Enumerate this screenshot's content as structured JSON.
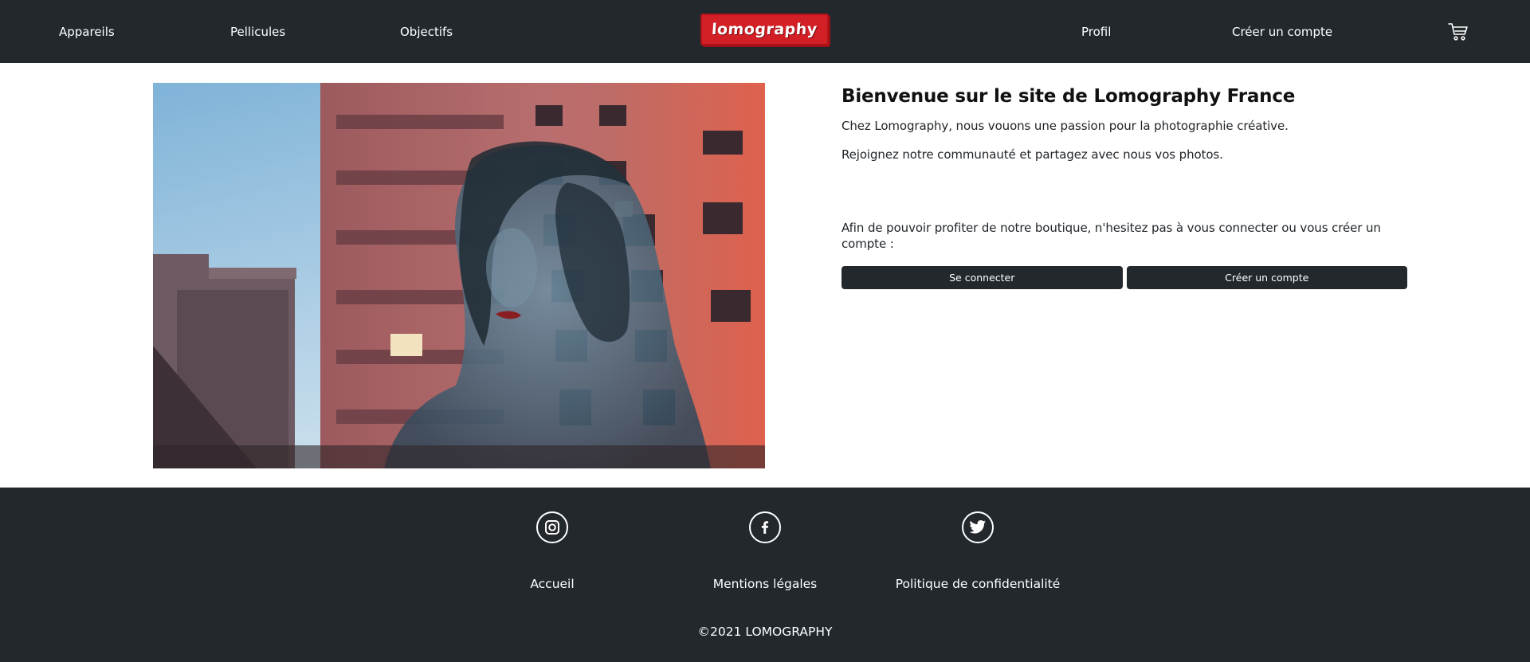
{
  "nav": {
    "items": [
      {
        "label": "Appareils"
      },
      {
        "label": "Pellicules"
      },
      {
        "label": "Objectifs"
      }
    ],
    "logo_text": "lomography",
    "right_items": [
      {
        "label": "Profil"
      },
      {
        "label": "Créer un compte"
      }
    ],
    "cart_icon": "shopping-cart-icon"
  },
  "hero": {
    "image_icon": "photo-double-exposure",
    "title": "Bienvenue sur le site de Lomography France",
    "paragraphs": [
      "Chez Lomography, nous vouons une passion pour la photographie créative.",
      "Rejoignez notre communauté et partagez avec nous vos photos."
    ],
    "invite": "Afin de pouvoir profiter de notre boutique, n'hesitez pas à vous connecter ou vous créer un compte :",
    "login_button": "Se connecter",
    "signup_button": "Créer un compte"
  },
  "footer": {
    "social": [
      {
        "icon": "instagram-icon"
      },
      {
        "icon": "facebook-icon"
      },
      {
        "icon": "twitter-icon"
      }
    ],
    "links": [
      {
        "label": "Accueil"
      },
      {
        "label": "Mentions légales"
      },
      {
        "label": "Politique de confidentialité"
      }
    ],
    "copyright": "©2021 LOMOGRAPHY"
  },
  "colors": {
    "dark": "#23282d",
    "brand_red": "#d31f26",
    "background": "#ffffff"
  }
}
